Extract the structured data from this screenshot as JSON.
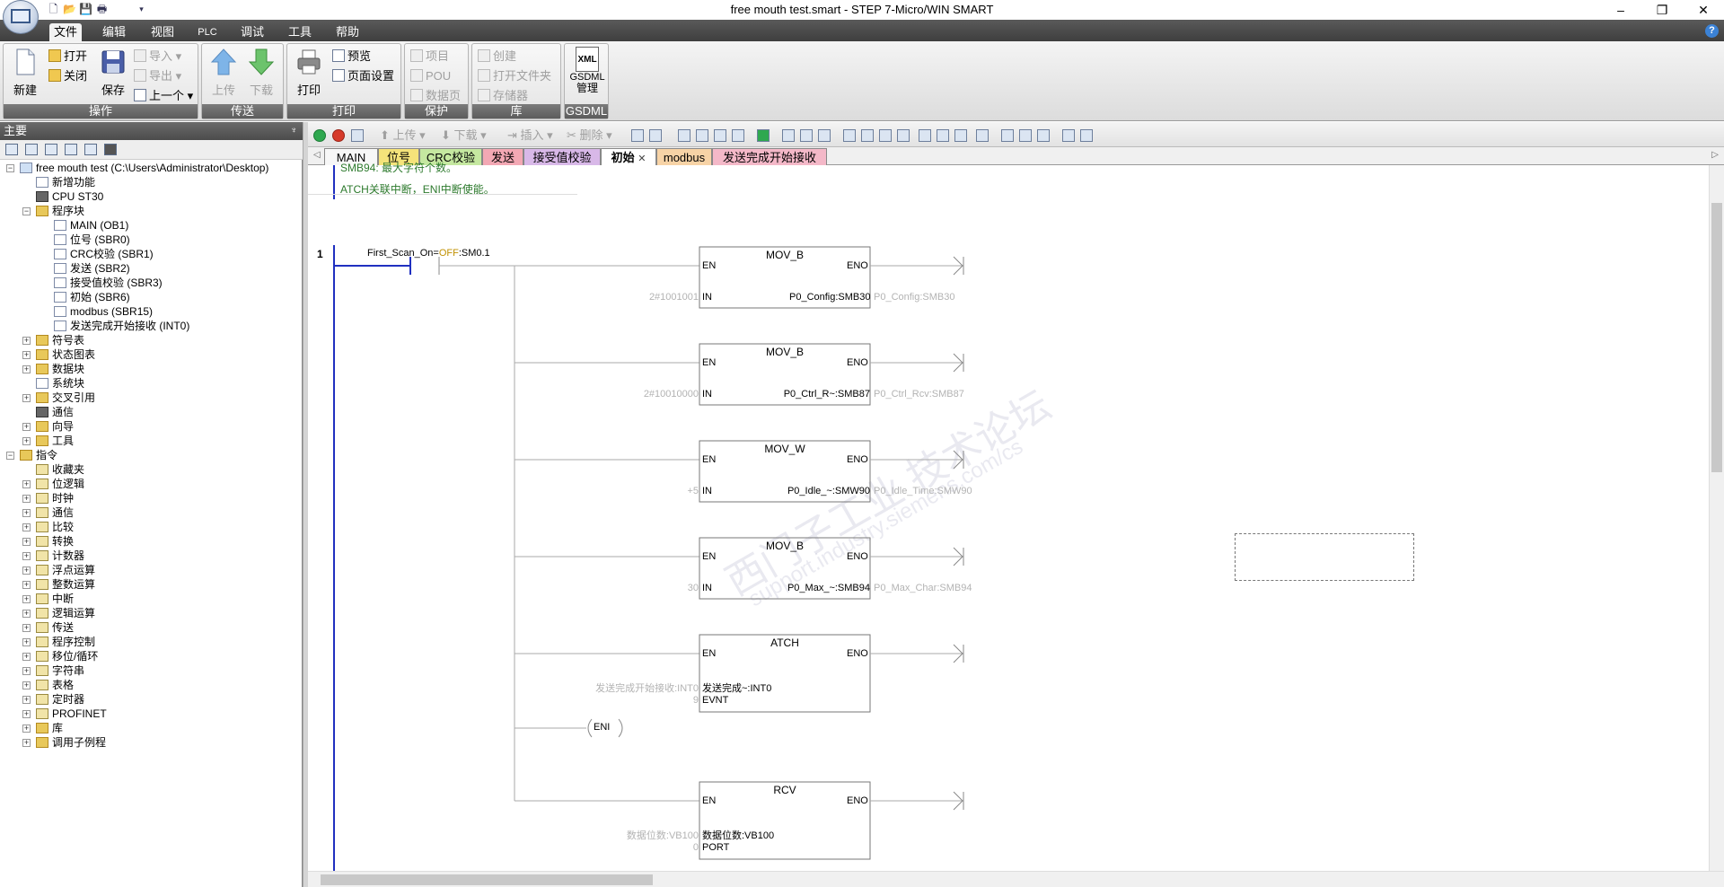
{
  "window": {
    "title": "free mouth test.smart - STEP 7-Micro/WIN SMART",
    "minimize": "–",
    "maximize": "❐",
    "close": "✕"
  },
  "ribbon_tabs": [
    "文件",
    "编辑",
    "视图",
    "PLC",
    "调试",
    "工具",
    "帮助"
  ],
  "ribbon": {
    "groups": {
      "operation": "操作",
      "transfer": "传送",
      "print": "打印",
      "protect": "保护",
      "library": "库",
      "gsdml": "GSDML"
    },
    "new": "新建",
    "open": "打开",
    "close": "关闭",
    "save": "保存",
    "import": "导入",
    "export": "导出",
    "previous": "上一个",
    "upload": "上传",
    "download": "下载",
    "print": "打印",
    "preview": "预览",
    "page_setup": "页面设置",
    "project": "项目",
    "pou": "POU",
    "data_page": "数据页",
    "create": "创建",
    "open_folder": "打开文件夹",
    "memory": "存储器",
    "gsdml_xml": "XML",
    "gsdml_manage_1": "GSDML",
    "gsdml_manage_2": "管理"
  },
  "left_pane": {
    "title": "主要",
    "pin": "♆"
  },
  "tree": {
    "root": "free mouth test (C:\\Users\\Administrator\\Desktop)",
    "new_features": "新增功能",
    "cpu": "CPU ST30",
    "program_block": "程序块",
    "programs": [
      "MAIN (OB1)",
      "位号 (SBR0)",
      "CRC校验 (SBR1)",
      "发送 (SBR2)",
      "接受值校验 (SBR3)",
      "初始 (SBR6)",
      "modbus (SBR15)",
      "发送完成开始接收 (INT0)"
    ],
    "project_items": [
      "符号表",
      "状态图表",
      "数据块",
      "系统块",
      "交叉引用",
      "通信",
      "向导",
      "工具"
    ],
    "instructions": "指令",
    "instruction_items": [
      "收藏夹",
      "位逻辑",
      "时钟",
      "通信",
      "比较",
      "转换",
      "计数器",
      "浮点运算",
      "整数运算",
      "中断",
      "逻辑运算",
      "传送",
      "程序控制",
      "移位/循环",
      "字符串",
      "表格",
      "定时器",
      "PROFINET",
      "库",
      "调用子例程"
    ]
  },
  "editor_toolbar": {
    "upload": "上传",
    "download": "下载",
    "insert": "插入",
    "delete": "删除"
  },
  "page_tabs": [
    {
      "label": "MAIN",
      "color": "#f7f7f7"
    },
    {
      "label": "位号",
      "color": "#f5e37a"
    },
    {
      "label": "CRC校验",
      "color": "#c5e8a0"
    },
    {
      "label": "发送",
      "color": "#f3a8b4"
    },
    {
      "label": "接受值校验",
      "color": "#d8b8e8"
    },
    {
      "label": "初始",
      "color": "#ffffff"
    },
    {
      "label": "modbus",
      "color": "#f7d3a6"
    },
    {
      "label": "发送完成开始接收",
      "color": "#f4b8c8"
    }
  ],
  "comments": {
    "line1": "SMB94: 最大字符个数。",
    "line2": "ATCH关联中断，ENI中断使能。"
  },
  "rung": {
    "number": "1",
    "contact_label": "First_Scan_On",
    "contact_eq": "=",
    "contact_state": "OFF",
    "contact_addr": ":SM0.1",
    "eni": "ENI"
  },
  "blocks": [
    {
      "title": "MOV_B",
      "en": "EN",
      "eno": "ENO",
      "in_label": "IN",
      "in_value": "2#1001001",
      "out_value": "P0_Config:SMB30",
      "out_ghost": "P0_Config:SMB30"
    },
    {
      "title": "MOV_B",
      "en": "EN",
      "eno": "ENO",
      "in_label": "IN",
      "in_value": "2#10010000",
      "out_value": "P0_Ctrl_R~:SMB87",
      "out_ghost": "P0_Ctrl_Rcv:SMB87"
    },
    {
      "title": "MOV_W",
      "en": "EN",
      "eno": "ENO",
      "in_label": "IN",
      "in_value": "+5",
      "out_value": "P0_Idle_~:SMW90",
      "out_ghost": "P0_Idle_Time:SMW90"
    },
    {
      "title": "MOV_B",
      "en": "EN",
      "eno": "ENO",
      "in_label": "IN",
      "in_value": "30",
      "out_value": "P0_Max_~:SMB94",
      "out_ghost": "P0_Max_Char:SMB94"
    },
    {
      "title": "ATCH",
      "en": "EN",
      "eno": "ENO",
      "in_label": "发送完成~:INT0",
      "in_value": "发送完成开始接收:INT0",
      "in2_label": "EVNT",
      "in2_value": "9"
    },
    {
      "title": "RCV",
      "en": "EN",
      "eno": "ENO",
      "in_label": "数据位数:VB100",
      "in_value": "数据位数:VB100",
      "in2_label": "PORT",
      "in2_value": "0"
    }
  ],
  "watermark": {
    "line1": "西门子工业   技术论坛",
    "line2": "support.industry.siemens.com/cs"
  },
  "colors": {
    "rail": "#2030c0",
    "comment": "#2d7a2d",
    "contact_state": "#c09000"
  }
}
